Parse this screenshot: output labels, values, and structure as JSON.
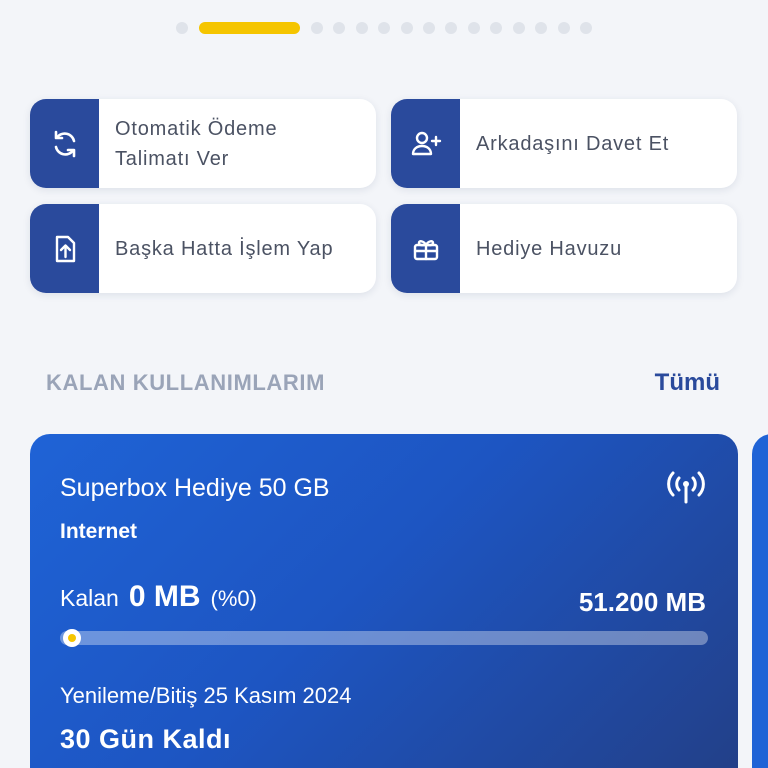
{
  "pager": {
    "page_count": 16,
    "active_index": 1
  },
  "actions": [
    {
      "label": "Otomatik Ödeme\nTalimatı Ver",
      "icon": "refresh-icon"
    },
    {
      "label": "Arkadaşını Davet Et",
      "icon": "add-user-icon"
    },
    {
      "label": "Başka Hatta İşlem Yap",
      "icon": "upload-file-icon"
    },
    {
      "label": "Hediye Havuzu",
      "icon": "gift-icon"
    }
  ],
  "section": {
    "title": "KALAN KULLANIMLARIM",
    "link": "Tümü"
  },
  "usage": {
    "package_name": "Superbox Hediye 50 GB",
    "type": "Internet",
    "remaining_label": "Kalan",
    "remaining_value": "0 MB",
    "remaining_percent": "(%0)",
    "remaining_fraction": 0.0,
    "total": "51.200 MB",
    "renew_text": "Yenileme/Bitiş 25 Kasım 2024",
    "days_left": "30 Gün Kaldı",
    "icon": "signal-tower-icon"
  },
  "colors": {
    "brand_blue": "#2a4a9c",
    "accent_yellow": "#f5c500",
    "card_gradient_start": "#1f63d6",
    "card_gradient_end": "#233f86"
  }
}
